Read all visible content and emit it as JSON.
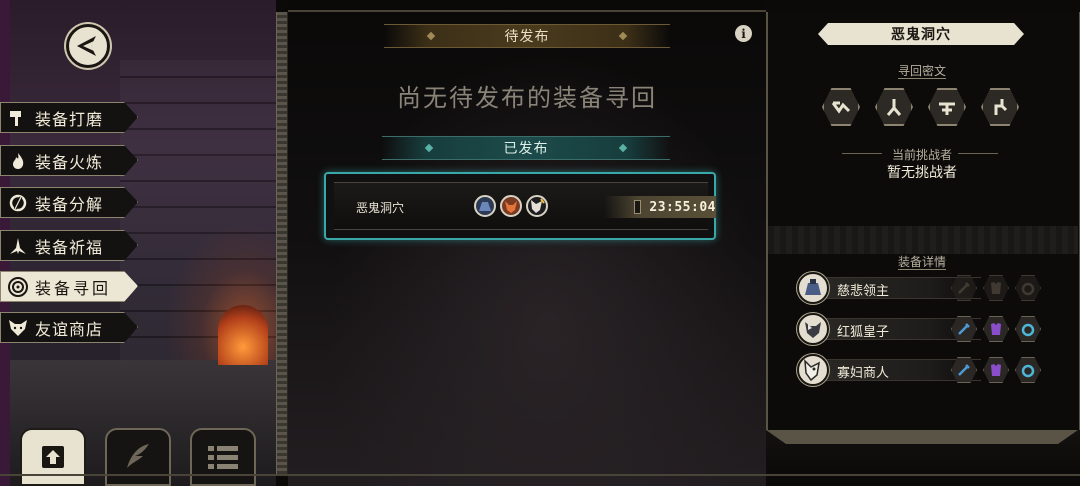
{
  "menu": {
    "items": [
      {
        "label": "装备打磨",
        "icon": "hammer-icon"
      },
      {
        "label": "装备火炼",
        "icon": "flame-icon"
      },
      {
        "label": "装备分解",
        "icon": "split-icon"
      },
      {
        "label": "装备祈福",
        "icon": "prayer-icon"
      },
      {
        "label": "装备寻回",
        "icon": "target-icon",
        "active": true
      },
      {
        "label": "友谊商店",
        "icon": "fox-icon"
      }
    ]
  },
  "bottom_tabs": [
    {
      "icon": "upload-icon",
      "active": true
    },
    {
      "icon": "feather-icon",
      "active": false
    },
    {
      "icon": "list-icon",
      "active": false
    }
  ],
  "pending": {
    "header": "待发布",
    "empty_text": "尚无待发布的装备寻回"
  },
  "published": {
    "header": "已发布",
    "quests": [
      {
        "name": "恶鬼洞穴",
        "timer": "23:55:04",
        "portraits": [
          "blue-armor-portrait",
          "red-fox-portrait",
          "white-wolf-portrait"
        ]
      }
    ]
  },
  "detail": {
    "title": "恶鬼洞穴",
    "cipher_label": "寻回密文",
    "runes": [
      "rune-v-icon",
      "rune-fork-icon",
      "rune-cross-icon",
      "rune-branch-icon"
    ],
    "challenger_label": "当前挑战者",
    "challenger_value": "暂无挑战者",
    "equip_label": "装备详情",
    "equipment": [
      {
        "name": "慈悲领主",
        "slots_filled": [
          false,
          false,
          false
        ]
      },
      {
        "name": "红狐皇子",
        "slots_filled": [
          true,
          true,
          true
        ]
      },
      {
        "name": "寡妇商人",
        "slots_filled": [
          true,
          true,
          true
        ]
      }
    ]
  },
  "colors": {
    "accent_teal": "#3aa8a8",
    "accent_gold": "#a08a58",
    "slot_sword": "#4e9ad6",
    "slot_armor": "#8a4ec8",
    "slot_ring": "#4eb6d6"
  }
}
